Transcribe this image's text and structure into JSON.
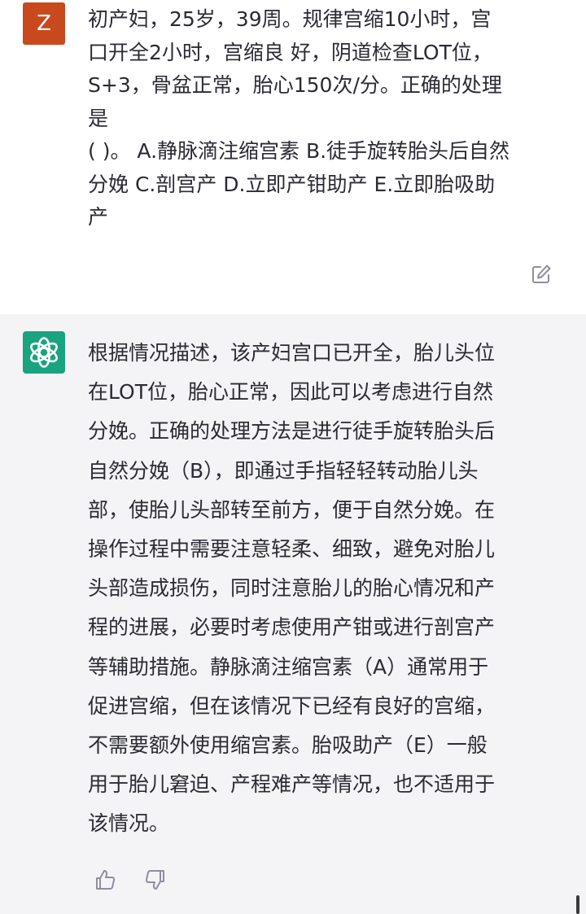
{
  "user_message": {
    "avatar_letter": "Z",
    "avatar_color": "#c9491f",
    "lines": [
      "初产妇，25岁，39周。规律宫缩10小时，宫",
      "口开全2小时，宫缩良 好，阴道检查LOT位，",
      "S+3，骨盆正常，胎心150次/分。正确的处理",
      "是",
      "( )。 A.静脉滴注缩宫素 B.徒手旋转胎头后自然",
      "分娩 C.剖宫产 D.立即产钳助产 E.立即胎吸助",
      "产"
    ],
    "edit_icon": "edit-icon"
  },
  "assistant_message": {
    "avatar_icon": "openai-logo-icon",
    "avatar_color": "#19a37f",
    "background": "#f4f4f6",
    "lines": [
      "根据情况描述，该产妇宫口已开全，胎儿头位",
      "在LOT位，胎心正常，因此可以考虑进行自然",
      "分娩。正确的处理方法是进行徒手旋转胎头后",
      "自然分娩（B），即通过手指轻轻转动胎儿头",
      "部，使胎儿头部转至前方，便于自然分娩。在",
      "操作过程中需要注意轻柔、细致，避免对胎儿",
      "头部造成损伤，同时注意胎儿的胎心情况和产",
      "程的进展，必要时考虑使用产钳或进行剖宫产",
      "等辅助措施。静脉滴注缩宫素（A）通常用于",
      "促进宫缩，但在该情况下已经有良好的宫缩，",
      "不需要额外使用缩宫素。胎吸助产（E）一般",
      "用于胎儿窘迫、产程难产等情况，也不适用于",
      "该情况。"
    ],
    "feedback_icons": [
      "thumbs-up-icon",
      "thumbs-down-icon"
    ]
  }
}
